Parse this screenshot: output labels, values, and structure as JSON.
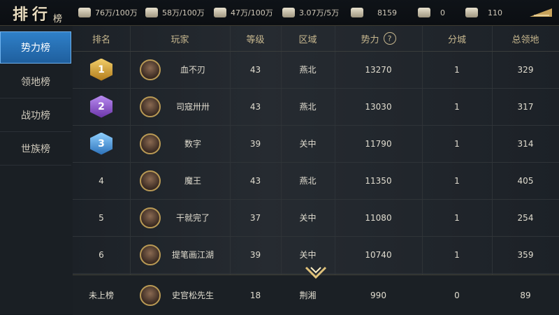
{
  "title": {
    "main": "排行",
    "sub": "榜"
  },
  "resources": [
    {
      "icon": "wheat-icon",
      "value": "76万/100万"
    },
    {
      "icon": "wood-icon",
      "value": "58万/100万"
    },
    {
      "icon": "stone-icon",
      "value": "47万/100万"
    },
    {
      "icon": "iron-icon",
      "value": "3.07万/5万"
    },
    {
      "icon": "command-icon",
      "value": "8159"
    },
    {
      "icon": "gold-icon",
      "value": "0"
    },
    {
      "icon": "silver-icon",
      "value": "110"
    }
  ],
  "sidebar": {
    "tabs": [
      {
        "label": "势力榜",
        "active": true
      },
      {
        "label": "领地榜",
        "active": false
      },
      {
        "label": "战功榜",
        "active": false
      },
      {
        "label": "世族榜",
        "active": false
      }
    ]
  },
  "table": {
    "headers": {
      "rank": "排名",
      "player": "玩家",
      "level": "等级",
      "region": "区域",
      "power": "势力",
      "help": "?",
      "branch": "分城",
      "territory": "总领地"
    },
    "rows": [
      {
        "rank": "1",
        "name": "血不刃",
        "level": "43",
        "region": "燕北",
        "power": "13270",
        "branch": "1",
        "territory": "329"
      },
      {
        "rank": "2",
        "name": "司寇卅卅",
        "level": "43",
        "region": "燕北",
        "power": "13030",
        "branch": "1",
        "territory": "317"
      },
      {
        "rank": "3",
        "name": "数字",
        "level": "39",
        "region": "关中",
        "power": "11790",
        "branch": "1",
        "territory": "314"
      },
      {
        "rank": "4",
        "name": "魔王",
        "level": "43",
        "region": "燕北",
        "power": "11350",
        "branch": "1",
        "territory": "405"
      },
      {
        "rank": "5",
        "name": "干就完了",
        "level": "37",
        "region": "关中",
        "power": "11080",
        "branch": "1",
        "territory": "254"
      },
      {
        "rank": "6",
        "name": "提笔画江湖",
        "level": "39",
        "region": "关中",
        "power": "10740",
        "branch": "1",
        "territory": "359"
      }
    ],
    "self": {
      "rank": "未上榜",
      "name": "史官松先生",
      "level": "18",
      "region": "荆湘",
      "power": "990",
      "branch": "0",
      "territory": "89"
    }
  },
  "colors": {
    "accent_blue": "#2f80c8",
    "gold": "#c8b88f",
    "medal_gold": "#d9a53a",
    "medal_purple": "#8a4fc9",
    "medal_blue": "#3b8fd9"
  }
}
